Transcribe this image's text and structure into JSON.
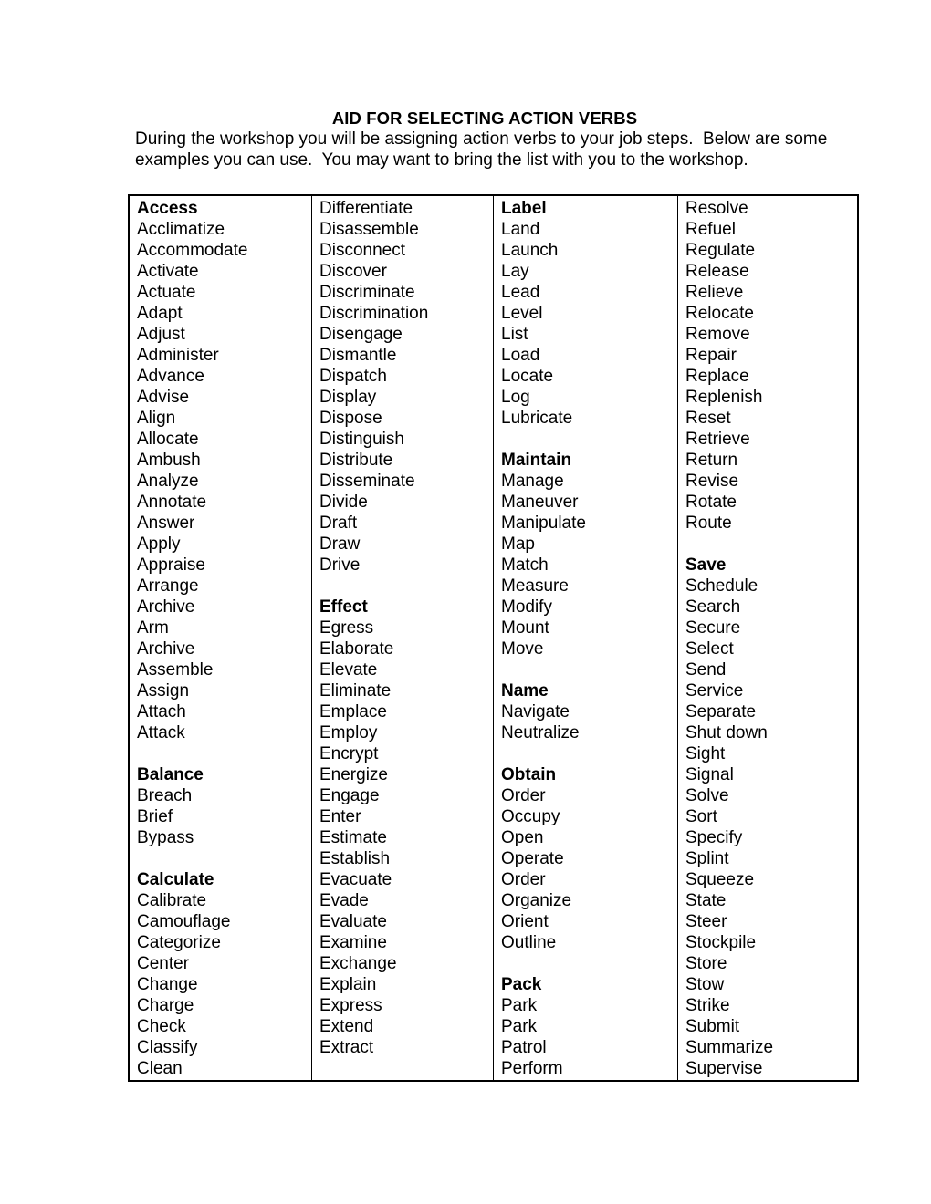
{
  "document": {
    "title": "AID FOR SELECTING ACTION VERBS",
    "intro": "During the workshop you will be assigning action verbs to your job steps.  Below are some examples you can use.  You may want to bring the list with you to the workshop."
  },
  "table": {
    "columns": [
      {
        "name": "column-1",
        "entries": [
          {
            "text": "Access",
            "bold": true
          },
          {
            "text": "Acclimatize",
            "bold": false
          },
          {
            "text": "Accommodate",
            "bold": false
          },
          {
            "text": "Activate",
            "bold": false
          },
          {
            "text": "Actuate",
            "bold": false
          },
          {
            "text": "Adapt",
            "bold": false
          },
          {
            "text": "Adjust",
            "bold": false
          },
          {
            "text": "Administer",
            "bold": false
          },
          {
            "text": "Advance",
            "bold": false
          },
          {
            "text": "Advise",
            "bold": false
          },
          {
            "text": "Align",
            "bold": false
          },
          {
            "text": "Allocate",
            "bold": false
          },
          {
            "text": "Ambush",
            "bold": false
          },
          {
            "text": "Analyze",
            "bold": false
          },
          {
            "text": "Annotate",
            "bold": false
          },
          {
            "text": "Answer",
            "bold": false
          },
          {
            "text": "Apply",
            "bold": false
          },
          {
            "text": "Appraise",
            "bold": false
          },
          {
            "text": "Arrange",
            "bold": false
          },
          {
            "text": "Archive",
            "bold": false
          },
          {
            "text": "Arm",
            "bold": false
          },
          {
            "text": "Archive",
            "bold": false
          },
          {
            "text": "Assemble",
            "bold": false
          },
          {
            "text": "Assign",
            "bold": false
          },
          {
            "text": "Attach",
            "bold": false
          },
          {
            "text": "Attack",
            "bold": false
          },
          {
            "text": "",
            "bold": false
          },
          {
            "text": "Balance",
            "bold": true
          },
          {
            "text": "Breach",
            "bold": false
          },
          {
            "text": "Brief",
            "bold": false
          },
          {
            "text": "Bypass",
            "bold": false
          },
          {
            "text": "",
            "bold": false
          },
          {
            "text": "Calculate",
            "bold": true
          },
          {
            "text": "Calibrate",
            "bold": false
          },
          {
            "text": "Camouflage",
            "bold": false
          },
          {
            "text": "Categorize",
            "bold": false
          },
          {
            "text": "Center",
            "bold": false
          },
          {
            "text": "Change",
            "bold": false
          },
          {
            "text": "Charge",
            "bold": false
          },
          {
            "text": "Check",
            "bold": false
          },
          {
            "text": "Classify",
            "bold": false
          },
          {
            "text": "Clean",
            "bold": false
          }
        ]
      },
      {
        "name": "column-2",
        "entries": [
          {
            "text": "Differentiate",
            "bold": false
          },
          {
            "text": "Disassemble",
            "bold": false
          },
          {
            "text": "Disconnect",
            "bold": false
          },
          {
            "text": "Discover",
            "bold": false
          },
          {
            "text": "Discriminate",
            "bold": false
          },
          {
            "text": "Discrimination",
            "bold": false
          },
          {
            "text": "Disengage",
            "bold": false
          },
          {
            "text": "Dismantle",
            "bold": false
          },
          {
            "text": "Dispatch",
            "bold": false
          },
          {
            "text": "Display",
            "bold": false
          },
          {
            "text": "Dispose",
            "bold": false
          },
          {
            "text": "Distinguish",
            "bold": false
          },
          {
            "text": "Distribute",
            "bold": false
          },
          {
            "text": "Disseminate",
            "bold": false
          },
          {
            "text": "Divide",
            "bold": false
          },
          {
            "text": "Draft",
            "bold": false
          },
          {
            "text": "Draw",
            "bold": false
          },
          {
            "text": "Drive",
            "bold": false
          },
          {
            "text": "",
            "bold": false
          },
          {
            "text": "Effect",
            "bold": true
          },
          {
            "text": "Egress",
            "bold": false
          },
          {
            "text": "Elaborate",
            "bold": false
          },
          {
            "text": "Elevate",
            "bold": false
          },
          {
            "text": "Eliminate",
            "bold": false
          },
          {
            "text": "Emplace",
            "bold": false
          },
          {
            "text": "Employ",
            "bold": false
          },
          {
            "text": "Encrypt",
            "bold": false
          },
          {
            "text": "Energize",
            "bold": false
          },
          {
            "text": "Engage",
            "bold": false
          },
          {
            "text": "Enter",
            "bold": false
          },
          {
            "text": "Estimate",
            "bold": false
          },
          {
            "text": "Establish",
            "bold": false
          },
          {
            "text": "Evacuate",
            "bold": false
          },
          {
            "text": "Evade",
            "bold": false
          },
          {
            "text": "Evaluate",
            "bold": false
          },
          {
            "text": "Examine",
            "bold": false
          },
          {
            "text": "Exchange",
            "bold": false
          },
          {
            "text": "Explain",
            "bold": false
          },
          {
            "text": "Express",
            "bold": false
          },
          {
            "text": "Extend",
            "bold": false
          },
          {
            "text": "Extract",
            "bold": false
          },
          {
            "text": "",
            "bold": false
          }
        ]
      },
      {
        "name": "column-3",
        "entries": [
          {
            "text": "Label",
            "bold": true
          },
          {
            "text": "Land",
            "bold": false
          },
          {
            "text": "Launch",
            "bold": false
          },
          {
            "text": "Lay",
            "bold": false
          },
          {
            "text": "Lead",
            "bold": false
          },
          {
            "text": "Level",
            "bold": false
          },
          {
            "text": "List",
            "bold": false
          },
          {
            "text": "Load",
            "bold": false
          },
          {
            "text": "Locate",
            "bold": false
          },
          {
            "text": "Log",
            "bold": false
          },
          {
            "text": "Lubricate",
            "bold": false
          },
          {
            "text": "",
            "bold": false
          },
          {
            "text": "Maintain",
            "bold": true
          },
          {
            "text": "Manage",
            "bold": false
          },
          {
            "text": "Maneuver",
            "bold": false
          },
          {
            "text": "Manipulate",
            "bold": false
          },
          {
            "text": "Map",
            "bold": false
          },
          {
            "text": "Match",
            "bold": false
          },
          {
            "text": "Measure",
            "bold": false
          },
          {
            "text": "Modify",
            "bold": false
          },
          {
            "text": "Mount",
            "bold": false
          },
          {
            "text": "Move",
            "bold": false
          },
          {
            "text": "",
            "bold": false
          },
          {
            "text": "Name",
            "bold": true
          },
          {
            "text": "Navigate",
            "bold": false
          },
          {
            "text": "Neutralize",
            "bold": false
          },
          {
            "text": "",
            "bold": false
          },
          {
            "text": "Obtain",
            "bold": true
          },
          {
            "text": "Order",
            "bold": false
          },
          {
            "text": "Occupy",
            "bold": false
          },
          {
            "text": "Open",
            "bold": false
          },
          {
            "text": "Operate",
            "bold": false
          },
          {
            "text": "Order",
            "bold": false
          },
          {
            "text": "Organize",
            "bold": false
          },
          {
            "text": "Orient",
            "bold": false
          },
          {
            "text": "Outline",
            "bold": false
          },
          {
            "text": "",
            "bold": false
          },
          {
            "text": "Pack",
            "bold": true
          },
          {
            "text": "Park",
            "bold": false
          },
          {
            "text": "Park",
            "bold": false
          },
          {
            "text": "Patrol",
            "bold": false
          },
          {
            "text": "Perform",
            "bold": false
          }
        ]
      },
      {
        "name": "column-4",
        "entries": [
          {
            "text": "Resolve",
            "bold": false
          },
          {
            "text": "Refuel",
            "bold": false
          },
          {
            "text": "Regulate",
            "bold": false
          },
          {
            "text": "Release",
            "bold": false
          },
          {
            "text": "Relieve",
            "bold": false
          },
          {
            "text": "Relocate",
            "bold": false
          },
          {
            "text": "Remove",
            "bold": false
          },
          {
            "text": "Repair",
            "bold": false
          },
          {
            "text": "Replace",
            "bold": false
          },
          {
            "text": "Replenish",
            "bold": false
          },
          {
            "text": "Reset",
            "bold": false
          },
          {
            "text": "Retrieve",
            "bold": false
          },
          {
            "text": "Return",
            "bold": false
          },
          {
            "text": "Revise",
            "bold": false
          },
          {
            "text": "Rotate",
            "bold": false
          },
          {
            "text": "Route",
            "bold": false
          },
          {
            "text": "",
            "bold": false
          },
          {
            "text": "Save",
            "bold": true
          },
          {
            "text": "Schedule",
            "bold": false
          },
          {
            "text": "Search",
            "bold": false
          },
          {
            "text": "Secure",
            "bold": false
          },
          {
            "text": "Select",
            "bold": false
          },
          {
            "text": "Send",
            "bold": false
          },
          {
            "text": "Service",
            "bold": false
          },
          {
            "text": "Separate",
            "bold": false
          },
          {
            "text": "Shut down",
            "bold": false
          },
          {
            "text": "Sight",
            "bold": false
          },
          {
            "text": "Signal",
            "bold": false
          },
          {
            "text": "Solve",
            "bold": false
          },
          {
            "text": "Sort",
            "bold": false
          },
          {
            "text": "Specify",
            "bold": false
          },
          {
            "text": "Splint",
            "bold": false
          },
          {
            "text": "Squeeze",
            "bold": false
          },
          {
            "text": "State",
            "bold": false
          },
          {
            "text": "Steer",
            "bold": false
          },
          {
            "text": "Stockpile",
            "bold": false
          },
          {
            "text": "Store",
            "bold": false
          },
          {
            "text": "Stow",
            "bold": false
          },
          {
            "text": "Strike",
            "bold": false
          },
          {
            "text": "Submit",
            "bold": false
          },
          {
            "text": "Summarize",
            "bold": false
          },
          {
            "text": "Supervise",
            "bold": false
          }
        ]
      }
    ]
  }
}
